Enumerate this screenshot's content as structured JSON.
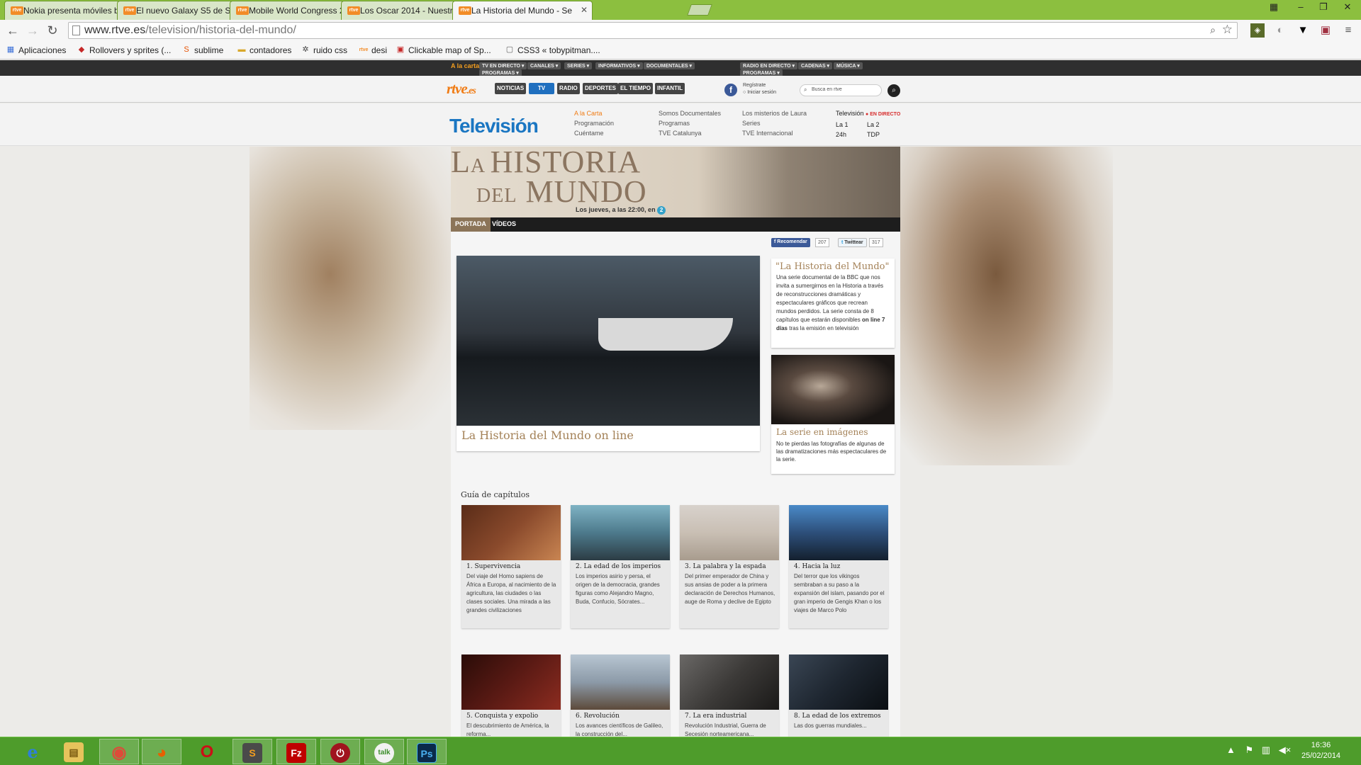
{
  "browser": {
    "tabs": [
      {
        "label": "Nokia presenta móviles ba",
        "favicon": "rtve"
      },
      {
        "label": "El nuevo Galaxy S5 de Sam",
        "favicon": "rtve"
      },
      {
        "label": "Mobile World Congress 20",
        "favicon": "rtve"
      },
      {
        "label": "Los Oscar 2014 - Nuestros",
        "favicon": "rtve"
      },
      {
        "label": "La Historia del Mundo - Se",
        "favicon": "rtve"
      }
    ],
    "url_host": "www.rtve.es",
    "url_path": "/television/historia-del-mundo/",
    "bookmarks": [
      {
        "label": "Aplicaciones",
        "icon": "apps-grid-icon"
      },
      {
        "label": "Rollovers y sprites (...",
        "icon": "ruby-icon"
      },
      {
        "label": "sublime",
        "icon": "sublime-icon"
      },
      {
        "label": "contadores",
        "icon": "folder-icon"
      },
      {
        "label": "ruido css",
        "icon": "gear-icon"
      },
      {
        "label": "desi",
        "icon": "rtve-icon"
      },
      {
        "label": "Clickable map of Sp...",
        "icon": "map-icon"
      },
      {
        "label": "CSS3 « tobypitman....",
        "icon": "page-icon"
      }
    ]
  },
  "rtve": {
    "top_links": [
      "A la carta",
      "TV EN DIRECTO ▾",
      "CANALES ▾",
      "SERIES ▾",
      "INFORMATIVOS ▾",
      "DOCUMENTALES ▾",
      "PROGRAMAS ▾",
      "RADIO EN DIRECTO ▾",
      "CADENAS ▾",
      "MÚSICA ▾",
      "PROGRAMAS ▾"
    ],
    "logo": "rtve",
    "logo_suffix": ".es",
    "main_nav": [
      "NOTICIAS",
      "TV",
      "RADIO",
      "DEPORTES",
      "EL TIEMPO",
      "INFANTIL"
    ],
    "register": "Regístrate",
    "login": "Iniciar sesión",
    "search_placeholder": "Busca en rtve",
    "section_title": "Televisión",
    "sub_col1": [
      "A la Carta",
      "Programación",
      "Cuéntame"
    ],
    "sub_col2": [
      "Somos Documentales",
      "Programas",
      "TVE Catalunya"
    ],
    "sub_col3": [
      "Los misterios de Laura",
      "Series",
      "TVE Internacional"
    ],
    "live_title": "Televisión",
    "live_badge": "● EN DIRECTO",
    "channels": [
      "La 1",
      "La 2",
      "24h",
      "TDP"
    ]
  },
  "program": {
    "title_line1_a": "L",
    "title_line1_b": "A ",
    "title_line1_c": "HISTORIA",
    "title_line2_a": "DEL",
    "title_line2_b": " MUNDO",
    "schedule": "Los jueves, a las 22:00, en",
    "channel_badge": "2",
    "tabs": [
      "PORTADA",
      "VÍDEOS"
    ],
    "recommend_label": "Recomendar",
    "recommend_count": "207",
    "tweet_label": "Twittear",
    "tweet_count": "317",
    "hero_title": "La Historia del Mundo on line",
    "intro_title": "\"La Historia del Mundo\"",
    "intro_text_1": "Una serie documental de la BBC que nos invita a sumergirnos en la Historia a través de reconstrucciones dramáticas y espectaculares gráficos que recrean mundos perdidos. La serie consta de 8 capítulos que estarán disponibles ",
    "intro_text_bold": "on line 7 días",
    "intro_text_2": " tras la emisión en televisión",
    "gallery_title": "La serie en imágenes",
    "gallery_text": "No te pierdas las fotografías de algunas de las dramatizaciones más espectaculares de la serie.",
    "guide_title": "Guía de capítulos",
    "episodes": [
      {
        "title": "1. Supervivencia",
        "text": "Del viaje del Homo sapiens de África a Europa, al nacimiento de la agricultura, las ciudades o las clases sociales. Una mirada a las grandes civilizaciones",
        "color": "#8a4a2c"
      },
      {
        "title": "2. La edad de los imperios",
        "text": "Los imperios asirio y persa, el origen de la democracia, grandes figuras como Alejandro Magno, Buda, Confucio, Sócrates...",
        "color": "#4d7a8c"
      },
      {
        "title": "3. La palabra y la espada",
        "text": "Del primer emperador de China y sus ansias de poder a la primera declaración de Derechos Humanos, auge de Roma y declive de Egipto",
        "color": "#c9bfb4"
      },
      {
        "title": "4. Hacia la luz",
        "text": "Del terror que los vikingos sembraban a su paso a la expansión del islam, pasando por el gran imperio de Gengis Khan o los viajes de Marco Polo",
        "color": "#2d4f7a"
      },
      {
        "title": "5. Conquista y expolio",
        "text": "El descubrimiento de América, la reforma...",
        "color": "#5a1a14"
      },
      {
        "title": "6. Revolución",
        "text": "Los avances científicos de Galileo, la construcción del...",
        "color": "#8c9aa8"
      },
      {
        "title": "7. La era industrial",
        "text": "Revolución Industrial, Guerra de Secesión norteamericana...",
        "color": "#3c3a38"
      },
      {
        "title": "8. La edad de los extremos",
        "text": "Las dos guerras mundiales...",
        "color": "#1e2630"
      }
    ]
  },
  "taskbar": {
    "apps": [
      {
        "name": "internet-explorer-icon",
        "glyph": "e",
        "color": "#2f7fd6"
      },
      {
        "name": "file-explorer-icon",
        "glyph": "▤",
        "color": "#e6c35c"
      },
      {
        "name": "chrome-icon",
        "glyph": "◉",
        "color": "#dd4b39"
      },
      {
        "name": "firefox-icon",
        "glyph": "◕",
        "color": "#e66000"
      },
      {
        "name": "opera-icon",
        "glyph": "O",
        "color": "#cc0f16"
      },
      {
        "name": "sublime-icon",
        "glyph": "S",
        "color": "#4a4a4a"
      },
      {
        "name": "filezilla-icon",
        "glyph": "Fz",
        "color": "#bf0000"
      },
      {
        "name": "power-icon",
        "glyph": "⏻",
        "color": "#a0141e"
      },
      {
        "name": "talk-icon",
        "glyph": "talk",
        "color": "#f2f2f2"
      },
      {
        "name": "photoshop-icon",
        "glyph": "Ps",
        "color": "#0a2a4a"
      }
    ],
    "time": "16:36",
    "date": "25/02/2014"
  },
  "colors": {
    "chrome_frame": "#8cbf3f",
    "rtve_orange": "#f07c15",
    "tv_blue": "#1a76c2",
    "serif_gold": "#a48258",
    "taskbar": "#4e9c2b"
  }
}
